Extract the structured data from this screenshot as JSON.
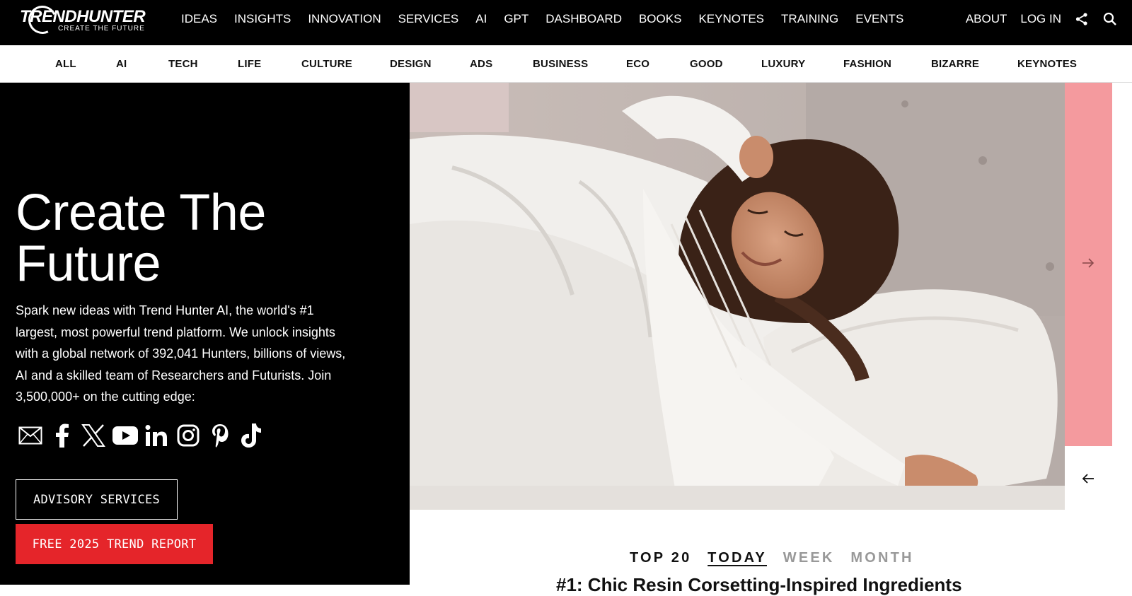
{
  "brand": {
    "name": "TRENDHUNTER",
    "tagline": "CREATE THE FUTURE"
  },
  "main_menu": [
    "IDEAS",
    "INSIGHTS",
    "INNOVATION",
    "SERVICES",
    "AI",
    "GPT",
    "DASHBOARD",
    "BOOKS",
    "KEYNOTES",
    "TRAINING",
    "EVENTS"
  ],
  "right_menu": {
    "about": "ABOUT",
    "login": "LOG IN",
    "share_icon": "share-icon",
    "search_icon": "search-icon"
  },
  "categories": [
    "ALL",
    "AI",
    "TECH",
    "LIFE",
    "CULTURE",
    "DESIGN",
    "ADS",
    "BUSINESS",
    "ECO",
    "GOOD",
    "LUXURY",
    "FASHION",
    "BIZARRE",
    "KEYNOTES"
  ],
  "hero": {
    "title_line1": "Create The",
    "title_line2": "Future",
    "description": "Spark new ideas with Trend Hunter AI, the world's #1 largest, most powerful trend platform. We unlock insights with a global network of 392,041 Hunters, billions of views, AI and a skilled team of Researchers and Futurists. Join 3,500,000+ on the cutting edge:",
    "socials": [
      "email-icon",
      "facebook-icon",
      "x-icon",
      "youtube-icon",
      "linkedin-icon",
      "instagram-icon",
      "pinterest-icon",
      "tiktok-icon"
    ],
    "advisory_button": "ADVISORY SERVICES",
    "report_button": "FREE 2025 TREND REPORT"
  },
  "carousel": {
    "next_icon": "arrow-right-icon",
    "prev_icon": "arrow-left-icon"
  },
  "top20": {
    "label": "TOP 20",
    "tabs": [
      "TODAY",
      "WEEK",
      "MONTH"
    ],
    "active_tab": "TODAY",
    "headline": "#1: Chic Resin Corsetting-Inspired Ingredients"
  },
  "colors": {
    "accent_red": "#e5252a",
    "pink_panel": "#f49a9e"
  }
}
